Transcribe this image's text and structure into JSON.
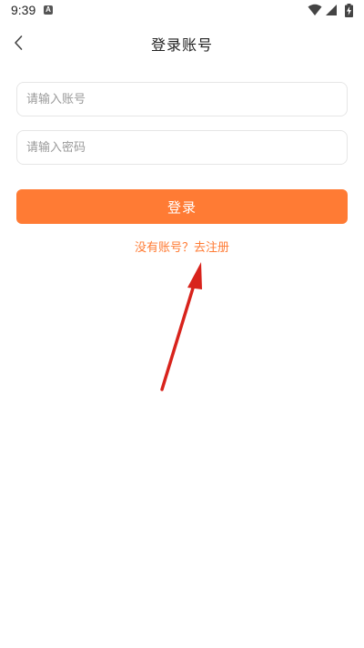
{
  "status_bar": {
    "time": "9:39",
    "notification_letter": "A",
    "icons": [
      "wifi-icon",
      "signal-icon",
      "battery-charging-icon"
    ]
  },
  "header": {
    "title": "登录账号",
    "back_icon": "chevron-left-icon"
  },
  "form": {
    "account_placeholder": "请输入账号",
    "password_placeholder": "请输入密码",
    "account_value": "",
    "password_value": ""
  },
  "login_button": {
    "label": "登录"
  },
  "register_link": {
    "label": "没有账号？去注册"
  },
  "colors": {
    "accent": "#ff7b34",
    "annotation_arrow": "#d8231c",
    "field_border": "#e6e6e6",
    "placeholder": "#9a9a9a"
  }
}
